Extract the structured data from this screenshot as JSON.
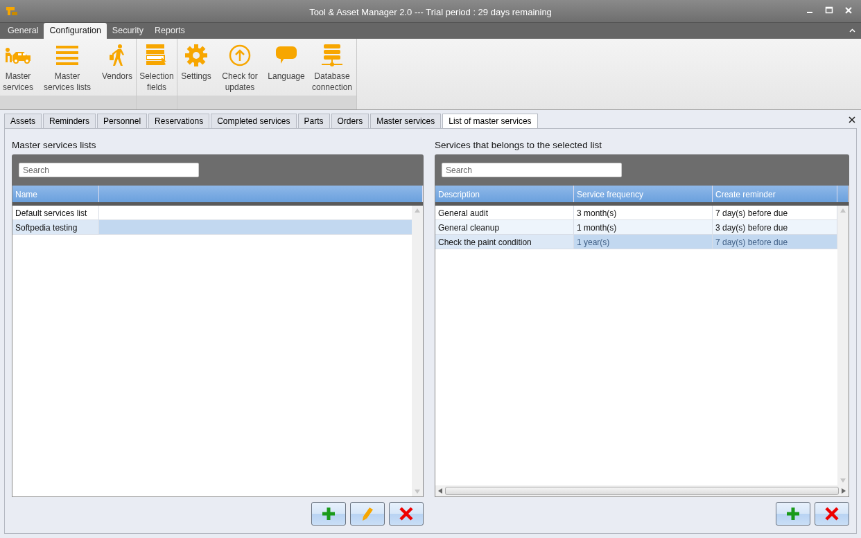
{
  "window": {
    "title": "Tool & Asset Manager 2.0 --- Trial period : 29 days remaining"
  },
  "ribbon": {
    "tabs": [
      {
        "label": "General",
        "selected": false
      },
      {
        "label": "Configuration",
        "selected": true
      },
      {
        "label": "Security",
        "selected": false
      },
      {
        "label": "Reports",
        "selected": false
      }
    ],
    "groups": [
      {
        "items": [
          {
            "label": "Master services"
          },
          {
            "label": "Master services lists"
          },
          {
            "label": "Vendors"
          }
        ]
      },
      {
        "items": [
          {
            "label": "Selection fields"
          }
        ]
      },
      {
        "items": [
          {
            "label": "Settings"
          },
          {
            "label": "Check for updates"
          },
          {
            "label": "Language"
          },
          {
            "label": "Database connection"
          }
        ]
      }
    ]
  },
  "doc_tabs": [
    {
      "label": "Assets",
      "selected": false
    },
    {
      "label": "Reminders",
      "selected": false
    },
    {
      "label": "Personnel",
      "selected": false
    },
    {
      "label": "Reservations",
      "selected": false
    },
    {
      "label": "Completed services",
      "selected": false
    },
    {
      "label": "Parts",
      "selected": false
    },
    {
      "label": "Orders",
      "selected": false
    },
    {
      "label": "Master services",
      "selected": false
    },
    {
      "label": "List of master services",
      "selected": true
    }
  ],
  "panels": [
    {
      "title": "Master services lists",
      "search": {
        "placeholder": "Search"
      },
      "columns": [
        "Name"
      ],
      "rows": [
        {
          "cells": [
            "Default services list"
          ],
          "selected": false
        },
        {
          "cells": [
            "Softpedia testing"
          ],
          "selected": true
        }
      ],
      "buttons": [
        {
          "kind": "add"
        },
        {
          "kind": "edit"
        },
        {
          "kind": "delete"
        }
      ]
    },
    {
      "title": "Services that belongs to the selected list",
      "search": {
        "placeholder": "Search"
      },
      "columns": [
        "Description",
        "Service frequency",
        "Create reminder"
      ],
      "rows": [
        {
          "cells": [
            "General audit",
            "3 month(s)",
            "7 day(s) before due"
          ],
          "selected": false
        },
        {
          "cells": [
            "General cleanup",
            "1 month(s)",
            "3 day(s) before due"
          ],
          "selected": false
        },
        {
          "cells": [
            "Check the paint condition",
            "1 year(s)",
            "7 day(s) before due"
          ],
          "selected": true
        }
      ],
      "buttons": [
        {
          "kind": "add"
        },
        {
          "kind": "delete"
        }
      ]
    }
  ]
}
